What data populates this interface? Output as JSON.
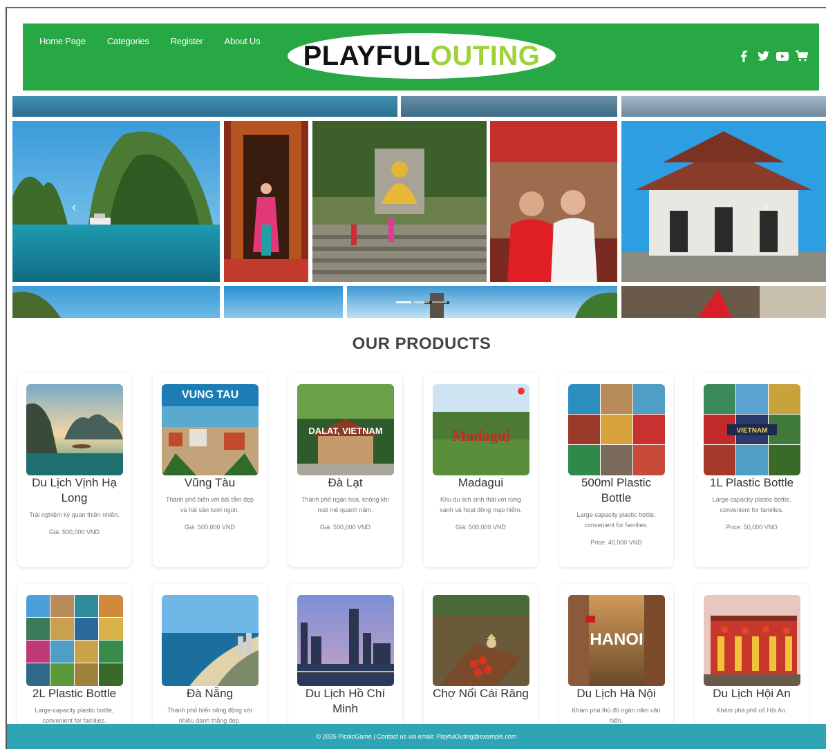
{
  "header": {
    "nav": [
      "Home Page",
      "Categories",
      "Register",
      "About Us"
    ],
    "logo_part1": "PLAYFUL",
    "logo_part2": "OUTING",
    "social_icons": [
      "facebook-icon",
      "twitter-icon",
      "youtube-icon",
      "cart-icon"
    ],
    "bg_color": "#28a745"
  },
  "products": {
    "title": "OUR PRODUCTS",
    "items": [
      {
        "name": "Du Lịch Vịnh Hạ Long",
        "desc": "Trải nghiệm kỳ quan thiên nhiên.",
        "price": "Giá: 500,000 VND"
      },
      {
        "name": "Vũng Tàu",
        "desc": "Thành phố biển với bãi tắm đẹp và hải sản tươi ngon.",
        "price": "Giá: 500,000 VND"
      },
      {
        "name": "Đà Lạt",
        "desc": "Thành phố ngàn hoa, không khí mát mẻ quanh năm.",
        "price": "Giá: 500,000 VND"
      },
      {
        "name": "Madagui",
        "desc": "Khu du lịch sinh thái với rừng xanh và hoạt động mạo hiểm.",
        "price": "Giá: 500,000 VND"
      },
      {
        "name": "500ml Plastic Bottle",
        "desc": "Large-capacity plastic bottle, convenient for families.",
        "price": "Price: 40,000 VND"
      },
      {
        "name": "1L Plastic Bottle",
        "desc": "Large-capacity plastic bottle, convenient for families.",
        "price": "Price: 50,000 VND"
      },
      {
        "name": "2L Plastic Bottle",
        "desc": "Large-capacity plastic bottle, convenient for families.",
        "price": ""
      },
      {
        "name": "Đà Nẵng",
        "desc": "Thành phố biển năng động với nhiều danh thắng đẹp.",
        "price": ""
      },
      {
        "name": "Du Lịch Hồ Chí Minh",
        "desc": "",
        "price": ""
      },
      {
        "name": "Chợ Nổi Cái Răng",
        "desc": "",
        "price": ""
      },
      {
        "name": "Du Lịch Hà Nội",
        "desc": "Khám phá thủ đô ngàn năm văn hiến.",
        "price": ""
      },
      {
        "name": "Du Lịch Hội An",
        "desc": "Khám phá phố cổ Hội An.",
        "price": ""
      }
    ],
    "image_text": {
      "vungtau": "VUNG TAU",
      "dalat": "DALAT, VIETNAM",
      "madagui": "Madagui",
      "vietnam": "VIETNAM",
      "hanoi": "HANOI"
    }
  },
  "footer": {
    "text": "© 2025 PicnicGame | Contact us via email: PlayfulOuting@example.com",
    "bg_color": "#2fa4b4"
  }
}
